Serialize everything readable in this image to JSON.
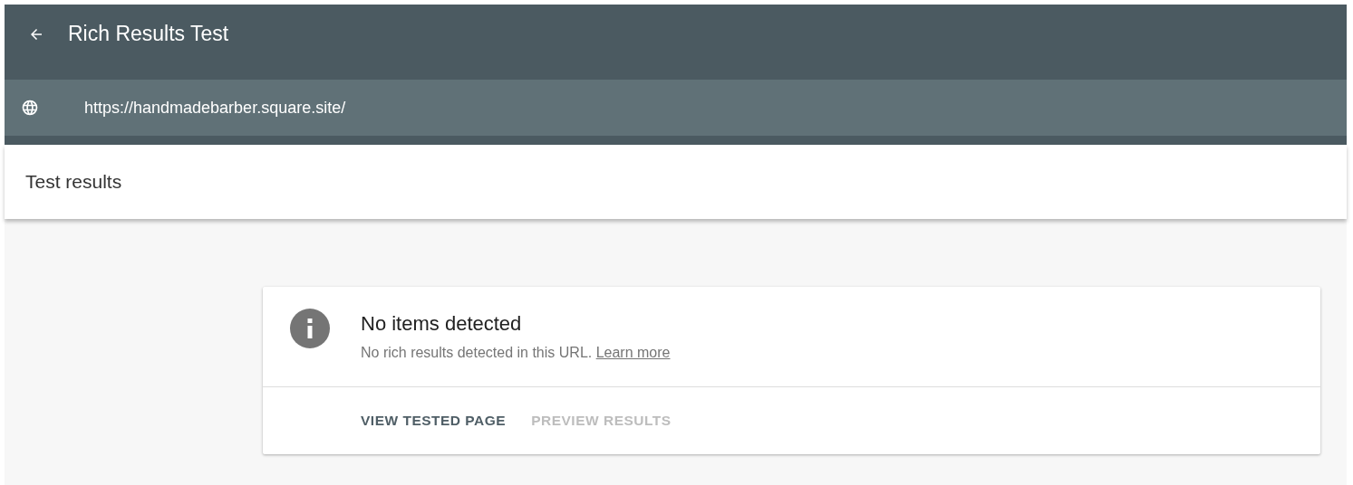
{
  "app_bar": {
    "title": "Rich Results Test"
  },
  "url_bar": {
    "url": "https://handmadebarber.square.site/"
  },
  "section": {
    "title": "Test results"
  },
  "result_card": {
    "heading": "No items detected",
    "message": "No rich results detected in this URL.",
    "link": "Learn more",
    "actions": [
      {
        "label": "VIEW TESTED PAGE",
        "disabled": false
      },
      {
        "label": "PREVIEW RESULTS",
        "disabled": true
      }
    ]
  }
}
